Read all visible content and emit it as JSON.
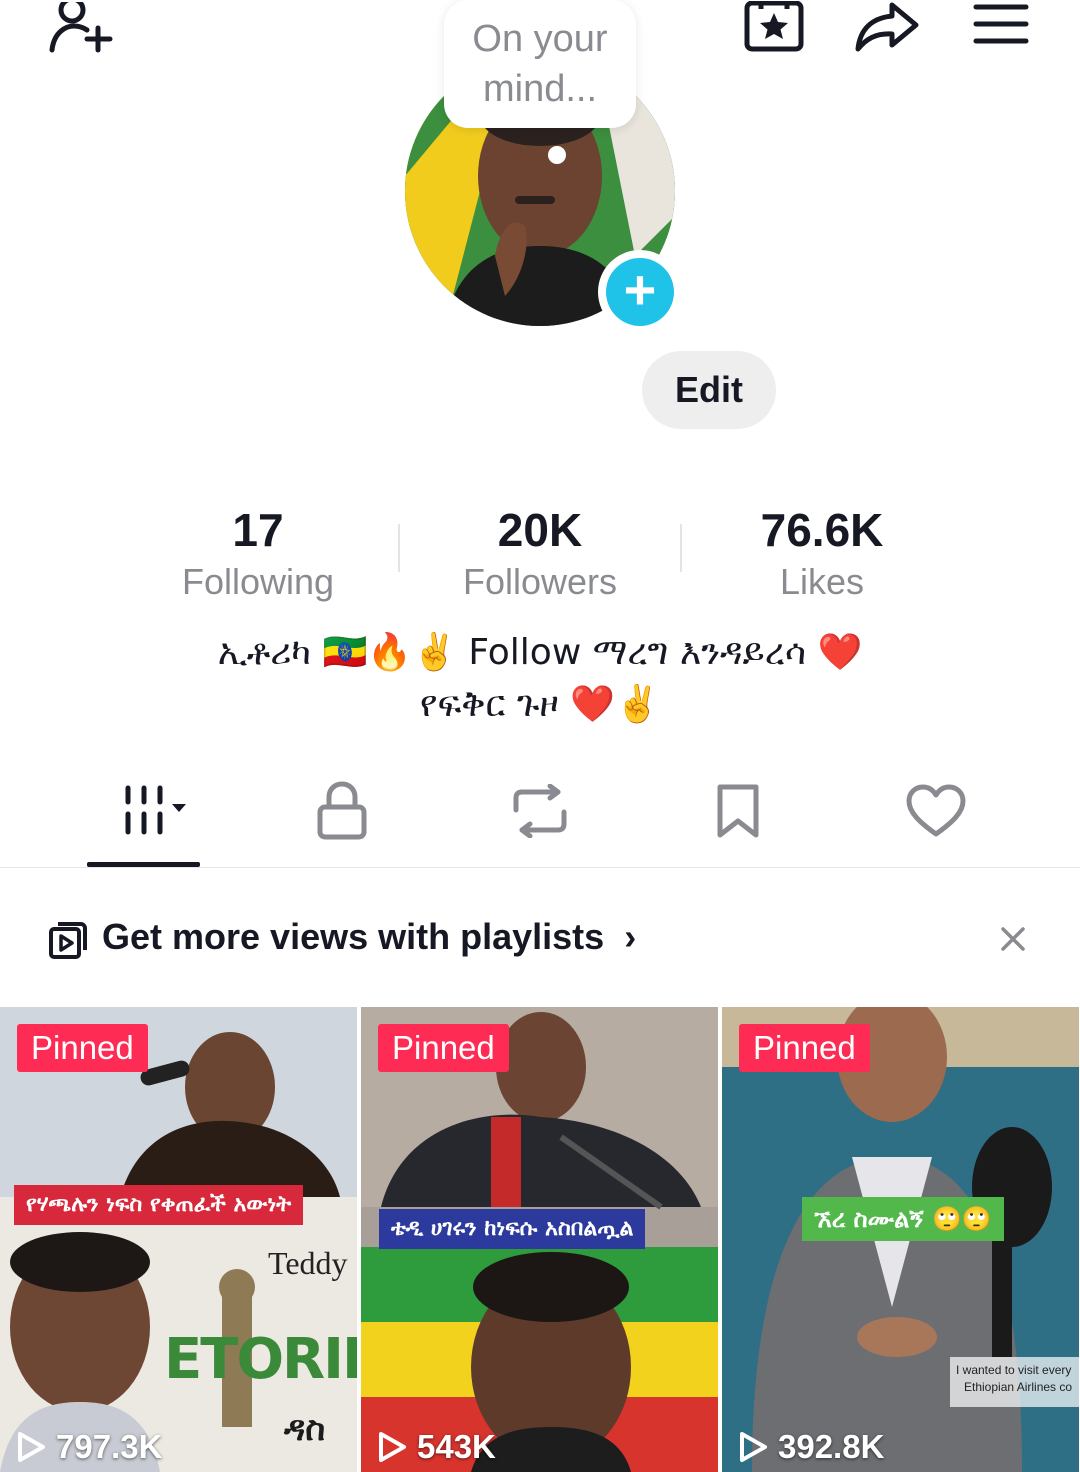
{
  "top_bar": {
    "icons": [
      "add-friend-icon",
      "favorites-icon",
      "share-icon",
      "menu-icon"
    ]
  },
  "mind_bubble": {
    "text": "On your mind..."
  },
  "profile": {
    "edit_label": "Edit",
    "avatar_add_icon": "plus-icon",
    "accent_color": "#20c3e8"
  },
  "stats": [
    {
      "value": "17",
      "label": "Following"
    },
    {
      "value": "20K",
      "label": "Followers"
    },
    {
      "value": "76.6K",
      "label": "Likes"
    }
  ],
  "bio": {
    "line1": "ኢቶሪካ 🇪🇹🔥✌️ Follow ማረግ እንዳይረሳ ❤️",
    "line2": "የፍቅር ጉዞ ❤️✌️"
  },
  "tabs": [
    {
      "icon": "grid-icon",
      "active": true
    },
    {
      "icon": "lock-icon",
      "active": false
    },
    {
      "icon": "repost-icon",
      "active": false
    },
    {
      "icon": "bookmark-icon",
      "active": false
    },
    {
      "icon": "heart-icon",
      "active": false
    }
  ],
  "playlist_banner": {
    "text": "Get more views with playlists",
    "chevron": "›"
  },
  "videos": [
    {
      "pinned_label": "Pinned",
      "views": "797.3K",
      "caption": "የሃጫሉን ነፍስ የቀጠፈች አውነት",
      "overlay_text": "Teddy",
      "overlay_text2": "ETORIK",
      "overlay_text3": "ዳስ"
    },
    {
      "pinned_label": "Pinned",
      "views": "543K",
      "caption": "ቴዲ ሀገሩን ከነፍሱ አስበልጧል"
    },
    {
      "pinned_label": "Pinned",
      "views": "392.8K",
      "caption": "ኧረ ስሙልኝ 🙄🙄",
      "overlay_text": "I wanted to visit every",
      "overlay_text2": "Ethiopian Airlines co"
    }
  ],
  "colors": {
    "pinned": "#fe2c55",
    "secondary_text": "#8a8b91",
    "primary_text": "#161823"
  }
}
